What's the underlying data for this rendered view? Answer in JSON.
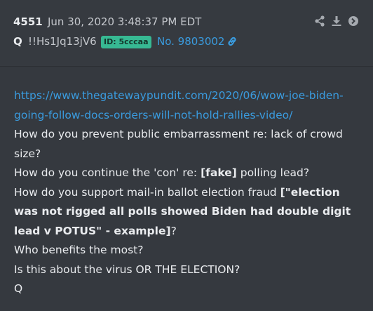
{
  "post": {
    "number": "4551",
    "date": "Jun 30, 2020 3:48:37 PM EDT",
    "name": "Q",
    "tripcode": "!!Hs1Jq13jV6",
    "id_badge": "ID: 5cccaa",
    "post_ref": "No. 9803002",
    "action_icons": [
      "share-icon",
      "download-icon",
      "arrow-right-icon"
    ],
    "colors": {
      "background": "#35393f",
      "text": "#e9ebee",
      "link": "#3a9bde",
      "id_badge": "#37b993"
    }
  },
  "body": {
    "url": "https://www.thegatewaypundit.com/2020/06/wow-joe-biden-going-follow-docs-orders-will-not-hold-rallies-video/",
    "line1": "How do you prevent public embarrassment re: lack of crowd size?",
    "line2_pre": "How do you continue the 'con' re: ",
    "line2_bold": "[fake]",
    "line2_post": " polling lead?",
    "line3_pre": "How do you support mail-in ballot election fraud ",
    "line3_bold": "[\"election was not rigged all polls showed Biden had double digit lead v POTUS\" - example]",
    "line3_post": "?",
    "line4": "Who benefits the most?",
    "line5": "Is this about the virus OR THE ELECTION?",
    "signoff": "Q"
  }
}
